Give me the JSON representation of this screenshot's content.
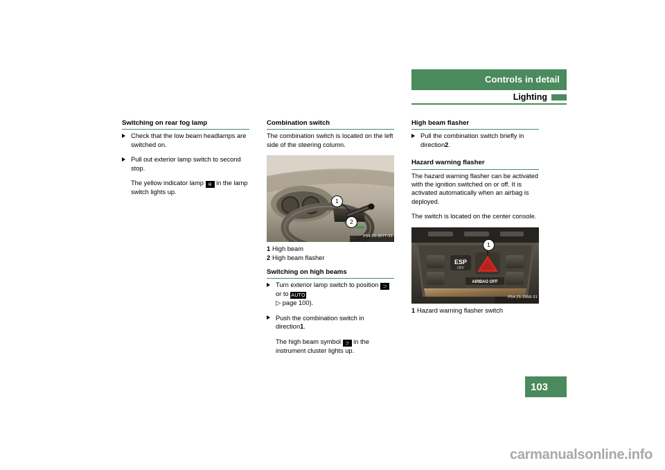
{
  "header": {
    "title": "Controls in detail",
    "subtitle": "Lighting",
    "bar_color": "#4a8a5c"
  },
  "page_number": "103",
  "watermark": "carmanualsonline.info",
  "columns": {
    "left": {
      "heading": "Switching on rear fog lamp",
      "bullet1": "Check that the low beam headlamps are switched on.",
      "bullet2": "Pull out exterior lamp switch to second stop.",
      "note_pre": "The yellow indicator lamp",
      "note_glyph": "rear-fog-lamp-symbol",
      "note_post": "in the lamp switch lights up."
    },
    "middle": {
      "heading": "Combination switch",
      "intro": "The combination switch is located on the left side of the steering column.",
      "figure_code": "P54.25-3077-31",
      "figure_callouts": [
        "1",
        "2"
      ],
      "legend": [
        {
          "num": "1",
          "text": "High beam"
        },
        {
          "num": "2",
          "text": "High beam flasher"
        }
      ],
      "heading2": "Switching on high beams",
      "bullet1_pre": "Turn exterior lamp switch to position",
      "bullet1_glyph1": "low-beam-symbol",
      "bullet1_mid": "or to",
      "bullet1_glyph2": "AUTO",
      "bullet1_ref_arrow": "▷",
      "bullet1_ref": "page 100).",
      "bullet2_pre": "Push the combination switch in direction",
      "bullet2_num": "1",
      "note_pre": "The high beam symbol",
      "note_glyph": "high-beam-symbol",
      "note_post": "in the instrument cluster lights up."
    },
    "right": {
      "heading": "High beam flasher",
      "bullet1_pre": "Pull the combination switch briefly in direction",
      "bullet1_num": "2",
      "heading2": "Hazard warning flasher",
      "para1": "The hazard warning flasher can be activated with the ignition switched on or off. It is activated automatically when an airbag is deployed.",
      "para2": "The switch is located on the center console.",
      "figure_code": "P54.25-2958-31",
      "figure_callouts": [
        "1"
      ],
      "figure_labels": {
        "esp": "ESP",
        "esp_off": "OFF",
        "airbag": "AIRBAG OFF"
      },
      "legend": [
        {
          "num": "1",
          "text": "Hazard warning flasher switch"
        }
      ]
    }
  }
}
